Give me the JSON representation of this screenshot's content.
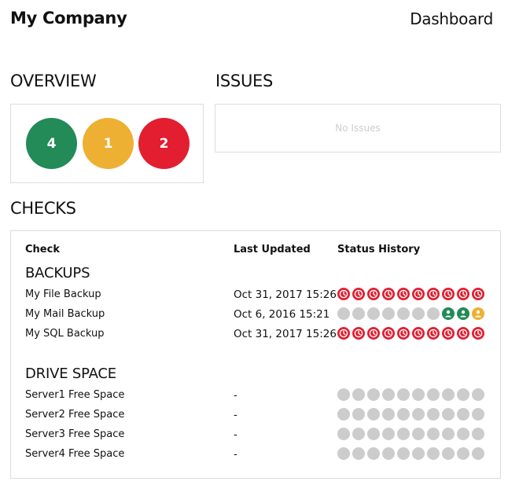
{
  "header": {
    "brand": "My Company",
    "nav_label": "Dashboard"
  },
  "overview": {
    "title": "OVERVIEW",
    "counts": [
      {
        "value": "4",
        "color": "#228b58",
        "status": "ok"
      },
      {
        "value": "1",
        "color": "#eeb033",
        "status": "warning"
      },
      {
        "value": "2",
        "color": "#e21e30",
        "status": "critical"
      }
    ]
  },
  "issues": {
    "title": "ISSUES",
    "empty_text": "No Issues"
  },
  "checks": {
    "title": "CHECKS",
    "columns": {
      "check": "Check",
      "last_updated": "Last Updated",
      "status_history": "Status History"
    },
    "colors": {
      "critical": "#e21e30",
      "ok": "#228b58",
      "warning": "#eeb033",
      "unknown": "#cccccc"
    },
    "groups": [
      {
        "name": "BACKUPS",
        "rows": [
          {
            "label": "My File Backup",
            "last_updated": "Oct 31, 2017 15:26",
            "history": [
              {
                "s": "critical",
                "icon": "clock-icon"
              },
              {
                "s": "critical",
                "icon": "clock-icon"
              },
              {
                "s": "critical",
                "icon": "clock-icon"
              },
              {
                "s": "critical",
                "icon": "clock-icon"
              },
              {
                "s": "critical",
                "icon": "clock-icon"
              },
              {
                "s": "critical",
                "icon": "clock-icon"
              },
              {
                "s": "critical",
                "icon": "clock-icon"
              },
              {
                "s": "critical",
                "icon": "clock-icon"
              },
              {
                "s": "critical",
                "icon": "clock-icon"
              },
              {
                "s": "critical",
                "icon": "clock-icon"
              }
            ]
          },
          {
            "label": "My Mail Backup",
            "last_updated": "Oct 6, 2016 15:21",
            "history": [
              {
                "s": "unknown",
                "icon": ""
              },
              {
                "s": "unknown",
                "icon": ""
              },
              {
                "s": "unknown",
                "icon": ""
              },
              {
                "s": "unknown",
                "icon": ""
              },
              {
                "s": "unknown",
                "icon": ""
              },
              {
                "s": "unknown",
                "icon": ""
              },
              {
                "s": "unknown",
                "icon": ""
              },
              {
                "s": "ok",
                "icon": "user-icon"
              },
              {
                "s": "ok",
                "icon": "user-icon"
              },
              {
                "s": "warning",
                "icon": "user-icon"
              }
            ]
          },
          {
            "label": "My SQL Backup",
            "last_updated": "Oct 31, 2017 15:26",
            "history": [
              {
                "s": "critical",
                "icon": "clock-icon"
              },
              {
                "s": "critical",
                "icon": "clock-icon"
              },
              {
                "s": "critical",
                "icon": "clock-icon"
              },
              {
                "s": "critical",
                "icon": "clock-icon"
              },
              {
                "s": "critical",
                "icon": "clock-icon"
              },
              {
                "s": "critical",
                "icon": "clock-icon"
              },
              {
                "s": "critical",
                "icon": "clock-icon"
              },
              {
                "s": "critical",
                "icon": "clock-icon"
              },
              {
                "s": "critical",
                "icon": "clock-icon"
              },
              {
                "s": "critical",
                "icon": "clock-icon"
              }
            ]
          }
        ]
      },
      {
        "name": "DRIVE SPACE",
        "rows": [
          {
            "label": "Server1 Free Space",
            "last_updated": "-",
            "history": [
              {
                "s": "unknown",
                "icon": ""
              },
              {
                "s": "unknown",
                "icon": ""
              },
              {
                "s": "unknown",
                "icon": ""
              },
              {
                "s": "unknown",
                "icon": ""
              },
              {
                "s": "unknown",
                "icon": ""
              },
              {
                "s": "unknown",
                "icon": ""
              },
              {
                "s": "unknown",
                "icon": ""
              },
              {
                "s": "unknown",
                "icon": ""
              },
              {
                "s": "unknown",
                "icon": ""
              },
              {
                "s": "unknown",
                "icon": ""
              }
            ]
          },
          {
            "label": "Server2 Free Space",
            "last_updated": "-",
            "history": [
              {
                "s": "unknown",
                "icon": ""
              },
              {
                "s": "unknown",
                "icon": ""
              },
              {
                "s": "unknown",
                "icon": ""
              },
              {
                "s": "unknown",
                "icon": ""
              },
              {
                "s": "unknown",
                "icon": ""
              },
              {
                "s": "unknown",
                "icon": ""
              },
              {
                "s": "unknown",
                "icon": ""
              },
              {
                "s": "unknown",
                "icon": ""
              },
              {
                "s": "unknown",
                "icon": ""
              },
              {
                "s": "unknown",
                "icon": ""
              }
            ]
          },
          {
            "label": "Server3 Free Space",
            "last_updated": "-",
            "history": [
              {
                "s": "unknown",
                "icon": ""
              },
              {
                "s": "unknown",
                "icon": ""
              },
              {
                "s": "unknown",
                "icon": ""
              },
              {
                "s": "unknown",
                "icon": ""
              },
              {
                "s": "unknown",
                "icon": ""
              },
              {
                "s": "unknown",
                "icon": ""
              },
              {
                "s": "unknown",
                "icon": ""
              },
              {
                "s": "unknown",
                "icon": ""
              },
              {
                "s": "unknown",
                "icon": ""
              },
              {
                "s": "unknown",
                "icon": ""
              }
            ]
          },
          {
            "label": "Server4 Free Space",
            "last_updated": "-",
            "history": [
              {
                "s": "unknown",
                "icon": ""
              },
              {
                "s": "unknown",
                "icon": ""
              },
              {
                "s": "unknown",
                "icon": ""
              },
              {
                "s": "unknown",
                "icon": ""
              },
              {
                "s": "unknown",
                "icon": ""
              },
              {
                "s": "unknown",
                "icon": ""
              },
              {
                "s": "unknown",
                "icon": ""
              },
              {
                "s": "unknown",
                "icon": ""
              },
              {
                "s": "unknown",
                "icon": ""
              },
              {
                "s": "unknown",
                "icon": ""
              }
            ]
          }
        ]
      }
    ]
  }
}
